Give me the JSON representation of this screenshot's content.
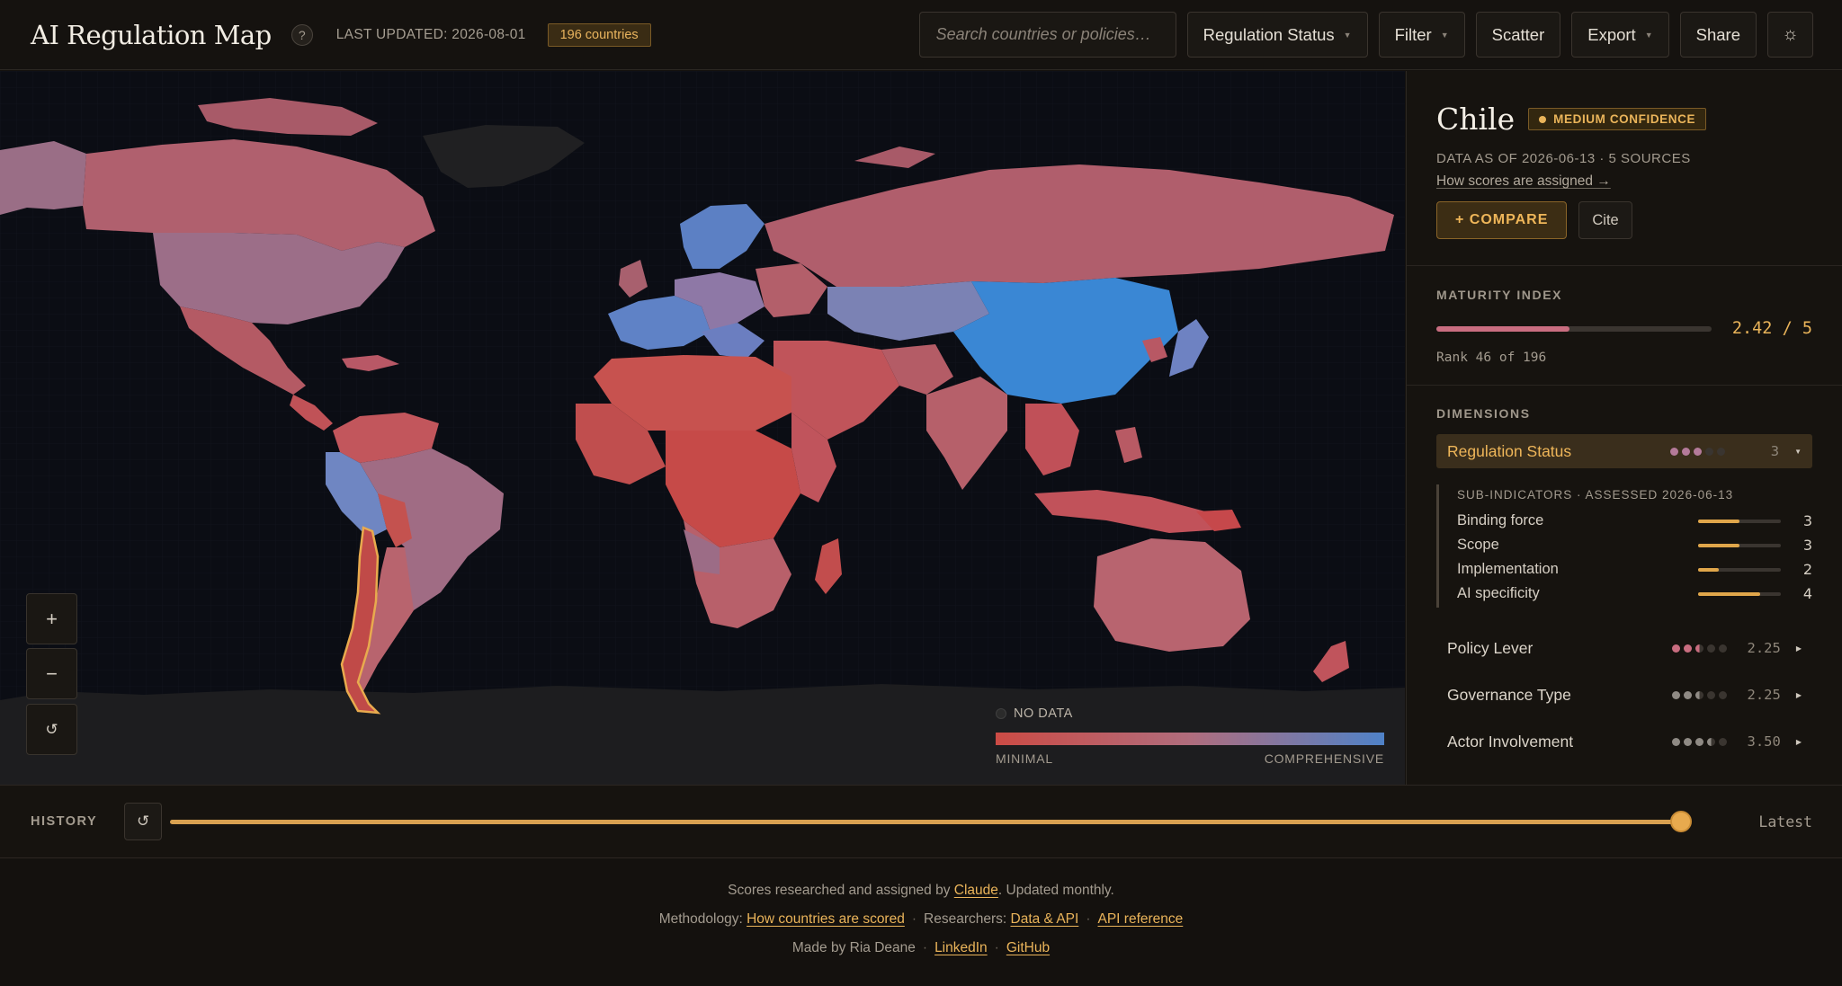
{
  "header": {
    "title": "AI Regulation Map",
    "help": "?",
    "last_updated": "LAST UPDATED: 2026-08-01",
    "count_badge": "196 countries",
    "search_placeholder": "Search countries or policies…",
    "regulation_status": "Regulation Status",
    "filter": "Filter",
    "scatter": "Scatter",
    "export": "Export",
    "share": "Share",
    "theme_icon": "☼"
  },
  "map": {
    "zoom_in": "+",
    "zoom_out": "−",
    "reset": "↺",
    "legend": {
      "no_data": "NO DATA",
      "min_label": "MINIMAL",
      "max_label": "COMPREHENSIVE",
      "colors": {
        "min": "#cc4b45",
        "mid": "#b06d7d",
        "max": "#4f82c8",
        "selected_outline": "#e8aa4e"
      }
    }
  },
  "panel": {
    "country": "Chile",
    "confidence": "MEDIUM CONFIDENCE",
    "data_as_of": "DATA AS OF 2026-06-13 · 5 SOURCES",
    "how_scores": "How scores are assigned →",
    "compare": "+ COMPARE",
    "cite": "Cite",
    "maturity": {
      "title": "MATURITY INDEX",
      "score": "2.42 / 5",
      "fraction": 0.484,
      "rank": "Rank 46 of 196"
    },
    "dimensions_title": "DIMENSIONS",
    "active_dimension": {
      "name": "Regulation Status",
      "value": "3",
      "dots": [
        1,
        1,
        1,
        0,
        0
      ],
      "sub_title": "SUB-INDICATORS · ASSESSED 2026-06-13",
      "sub_indicators": [
        {
          "name": "Binding force",
          "value": "3",
          "fraction": 0.5
        },
        {
          "name": "Scope",
          "value": "3",
          "fraction": 0.5
        },
        {
          "name": "Implementation",
          "value": "2",
          "fraction": 0.25
        },
        {
          "name": "AI specificity",
          "value": "4",
          "fraction": 0.75
        }
      ]
    },
    "dimensions": [
      {
        "name": "Policy Lever",
        "value": "2.25",
        "dots": [
          1,
          1,
          0.5,
          0,
          0
        ],
        "color": "#c96d80"
      },
      {
        "name": "Governance Type",
        "value": "2.25",
        "dots": [
          1,
          1,
          0.5,
          0,
          0
        ],
        "color": "#8f8a84"
      },
      {
        "name": "Actor Involvement",
        "value": "3.50",
        "dots": [
          1,
          1,
          1,
          0.5,
          0
        ],
        "color": "#8f8a84"
      }
    ]
  },
  "history": {
    "label": "HISTORY",
    "reset_icon": "↺",
    "position": 1.0,
    "latest": "Latest"
  },
  "footer": {
    "line1_pre": "Scores researched and assigned by ",
    "line1_link": "Claude",
    "line1_post": ". Updated monthly.",
    "methodology_label": "Methodology: ",
    "methodology_link": "How countries are scored",
    "researchers_label": "Researchers: ",
    "data_api_link": "Data & API",
    "api_ref_link": "API reference",
    "made_by": "Made by Ria Deane",
    "linkedin": "LinkedIn",
    "github": "GitHub"
  }
}
